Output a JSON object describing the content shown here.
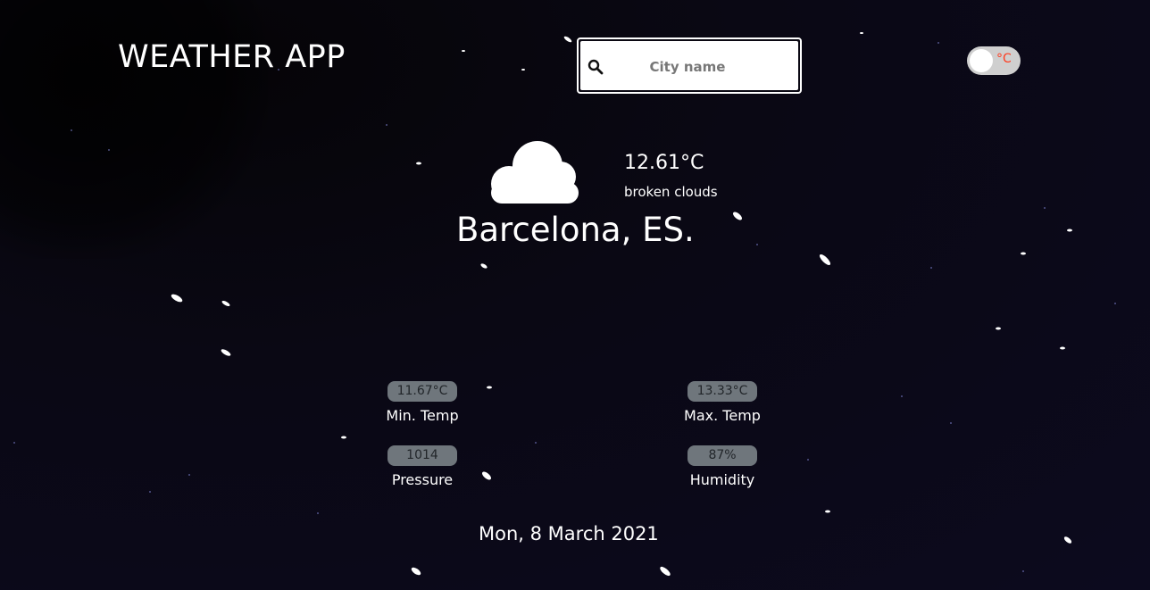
{
  "header": {
    "app_title": "WEATHER APP"
  },
  "search": {
    "placeholder": "City name",
    "value": "",
    "icon": "search-icon"
  },
  "unit_toggle": {
    "label": "°C",
    "label_color": "#ff3b1f"
  },
  "current": {
    "icon": "cloud-icon",
    "temperature": "12.61°C",
    "description": "broken clouds",
    "location": "Barcelona, ES."
  },
  "stats": {
    "min_temp": {
      "value": "11.67°C",
      "label": "Min. Temp"
    },
    "max_temp": {
      "value": "13.33°C",
      "label": "Max. Temp"
    },
    "pressure": {
      "value": "1014",
      "label": "Pressure"
    },
    "humidity": {
      "value": "87%",
      "label": "Humidity"
    }
  },
  "date": "Mon, 8 March 2021",
  "colors": {
    "background": "#0a0812",
    "badge": "#6f767c",
    "text": "#ffffff"
  }
}
